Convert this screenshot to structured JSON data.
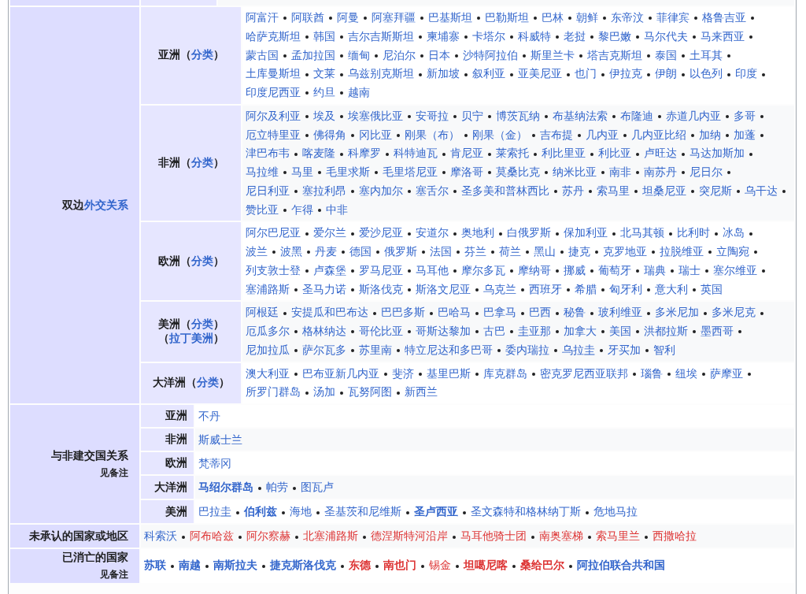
{
  "sections": [
    {
      "label": [
        {
          "text": "双边",
          "link": false
        },
        {
          "text": "外交关系",
          "link": true
        }
      ],
      "rows": [
        {
          "label": [
            [
              {
                "text": "亚洲（",
                "link": false
              },
              {
                "text": "分类",
                "link": true
              },
              {
                "text": "）",
                "link": false
              }
            ]
          ],
          "items": [
            "阿富汗",
            "阿联酋",
            "阿曼",
            "阿塞拜疆",
            "巴基斯坦",
            "巴勒斯坦",
            "巴林",
            "朝鲜",
            "东帝汶",
            "菲律宾",
            "格鲁吉亚",
            "哈萨克斯坦",
            "韩国",
            "吉尔吉斯斯坦",
            "柬埔寨",
            "卡塔尔",
            "科威特",
            "老挝",
            "黎巴嫩",
            "马尔代夫",
            "马来西亚",
            "蒙古国",
            "孟加拉国",
            "缅甸",
            "尼泊尔",
            "日本",
            "沙特阿拉伯",
            "斯里兰卡",
            "塔吉克斯坦",
            "泰国",
            "土耳其",
            "土库曼斯坦",
            "文莱",
            "乌兹别克斯坦",
            "新加坡",
            "叙利亚",
            "亚美尼亚",
            "也门",
            "伊拉克",
            "伊朗",
            "以色列",
            "印度",
            "印度尼西亚",
            "约旦",
            "越南"
          ]
        },
        {
          "label": [
            [
              {
                "text": "非洲（",
                "link": false
              },
              {
                "text": "分类",
                "link": true
              },
              {
                "text": "）",
                "link": false
              }
            ]
          ],
          "items": [
            "阿尔及利亚",
            "埃及",
            "埃塞俄比亚",
            "安哥拉",
            "贝宁",
            "博茨瓦纳",
            "布基纳法索",
            "布隆迪",
            "赤道几内亚",
            "多哥",
            "厄立特里亚",
            "佛得角",
            "冈比亚",
            "刚果（布）",
            "刚果（金）",
            "吉布提",
            "几内亚",
            "几内亚比绍",
            "加纳",
            "加蓬",
            "津巴布韦",
            "喀麦隆",
            "科摩罗",
            "科特迪瓦",
            "肯尼亚",
            "莱索托",
            "利比里亚",
            "利比亚",
            "卢旺达",
            "马达加斯加",
            "马拉维",
            "马里",
            "毛里求斯",
            "毛里塔尼亚",
            "摩洛哥",
            "莫桑比克",
            "纳米比亚",
            "南非",
            "南苏丹",
            "尼日尔",
            "尼日利亚",
            "塞拉利昂",
            "塞内加尔",
            "塞舌尔",
            "圣多美和普林西比",
            "苏丹",
            "索马里",
            "坦桑尼亚",
            "突尼斯",
            "乌干达",
            "赞比亚",
            "乍得",
            "中非"
          ]
        },
        {
          "label": [
            [
              {
                "text": "欧洲（",
                "link": false
              },
              {
                "text": "分类",
                "link": true
              },
              {
                "text": "）",
                "link": false
              }
            ]
          ],
          "items": [
            "阿尔巴尼亚",
            "爱尔兰",
            "爱沙尼亚",
            "安道尔",
            "奥地利",
            "白俄罗斯",
            "保加利亚",
            "北马其顿",
            "比利时",
            "冰岛",
            "波兰",
            "波黑",
            "丹麦",
            "德国",
            "俄罗斯",
            "法国",
            "芬兰",
            "荷兰",
            "黑山",
            "捷克",
            "克罗地亚",
            "拉脱维亚",
            "立陶宛",
            "列支敦士登",
            "卢森堡",
            "罗马尼亚",
            "马耳他",
            "摩尔多瓦",
            "摩纳哥",
            "挪威",
            "葡萄牙",
            "瑞典",
            "瑞士",
            "塞尔维亚",
            "塞浦路斯",
            "圣马力诺",
            "斯洛伐克",
            "斯洛文尼亚",
            "乌克兰",
            "西班牙",
            "希腊",
            "匈牙利",
            "意大利",
            "英国"
          ]
        },
        {
          "label": [
            [
              {
                "text": "美洲（",
                "link": false
              },
              {
                "text": "分类",
                "link": true
              },
              {
                "text": "）",
                "link": false
              }
            ],
            [
              {
                "text": "（",
                "link": false
              },
              {
                "text": "拉丁美洲",
                "link": true
              },
              {
                "text": "）",
                "link": false
              }
            ]
          ],
          "items": [
            "阿根廷",
            "安提瓜和巴布达",
            "巴巴多斯",
            "巴哈马",
            "巴拿马",
            "巴西",
            "秘鲁",
            "玻利维亚",
            "多米尼加",
            "多米尼克",
            "厄瓜多尔",
            "格林纳达",
            "哥伦比亚",
            "哥斯达黎加",
            "古巴",
            "圭亚那",
            "加拿大",
            "美国",
            "洪都拉斯",
            "墨西哥",
            "尼加拉瓜",
            "萨尔瓦多",
            "苏里南",
            "特立尼达和多巴哥",
            "委内瑞拉",
            "乌拉圭",
            "牙买加",
            "智利"
          ]
        },
        {
          "label": [
            [
              {
                "text": "大洋洲（",
                "link": false
              },
              {
                "text": "分类",
                "link": true
              },
              {
                "text": "）",
                "link": false
              }
            ]
          ],
          "items": [
            "澳大利亚",
            "巴布亚新几内亚",
            "斐济",
            "基里巴斯",
            "库克群岛",
            "密克罗尼西亚联邦",
            "瑙鲁",
            "纽埃",
            "萨摩亚",
            "所罗门群岛",
            "汤加",
            "瓦努阿图",
            "新西兰"
          ]
        }
      ]
    },
    {
      "label": [
        {
          "text": "与非建交国关系",
          "link": false
        }
      ],
      "note": "见备注",
      "rows": [
        {
          "label": [
            [
              {
                "text": "亚洲",
                "link": false
              }
            ]
          ],
          "items": [
            "不丹"
          ]
        },
        {
          "label": [
            [
              {
                "text": "非洲",
                "link": false
              }
            ]
          ],
          "items": [
            "斯威士兰"
          ]
        },
        {
          "label": [
            [
              {
                "text": "欧洲",
                "link": false
              }
            ]
          ],
          "items": [
            "梵蒂冈"
          ]
        },
        {
          "label": [
            [
              {
                "text": "大洋洲",
                "link": false
              }
            ]
          ],
          "items": [
            {
              "text": "马绍尔群岛",
              "color": "#3366cc",
              "bold": true
            },
            {
              "text": "帕劳",
              "color": "#3366cc",
              "bold": false
            },
            {
              "text": "图瓦卢",
              "color": "#3366cc",
              "bold": false
            }
          ]
        },
        {
          "label": [
            [
              {
                "text": "美洲",
                "link": false
              }
            ]
          ],
          "items": [
            {
              "text": "巴拉圭",
              "color": "#3366cc",
              "bold": false
            },
            {
              "text": "伯利兹",
              "color": "#3366cc",
              "bold": true
            },
            {
              "text": "海地",
              "color": "#3366cc",
              "bold": false
            },
            {
              "text": "圣基茨和尼维斯",
              "color": "#3366cc",
              "bold": false
            },
            {
              "text": "圣卢西亚",
              "color": "#3366cc",
              "bold": true
            },
            {
              "text": "圣文森特和格林纳丁斯",
              "color": "#3366cc",
              "bold": false
            },
            {
              "text": "危地马拉",
              "color": "#3366cc",
              "bold": false
            }
          ]
        }
      ]
    },
    {
      "label": [
        {
          "text": "未承认的国家或地区",
          "link": false
        }
      ],
      "items": [
        {
          "text": "科索沃",
          "color": "#3366cc",
          "bold": false
        },
        {
          "text": "阿布哈兹",
          "color": "#dd3333",
          "bold": false
        },
        {
          "text": "阿尔察赫",
          "color": "#dd3333",
          "bold": false
        },
        {
          "text": "北塞浦路斯",
          "color": "#dd3333",
          "bold": false
        },
        {
          "text": "德涅斯特河沿岸",
          "color": "#dd3333",
          "bold": false
        },
        {
          "text": "马耳他骑士团",
          "color": "#dd3333",
          "bold": false
        },
        {
          "text": "南奥塞梯",
          "color": "#dd3333",
          "bold": false
        },
        {
          "text": "索马里兰",
          "color": "#dd3333",
          "bold": false
        },
        {
          "text": "西撒哈拉",
          "color": "#dd3333",
          "bold": false
        }
      ]
    },
    {
      "label": [
        {
          "text": "已消亡的国家",
          "link": false
        }
      ],
      "note": "见备注",
      "items": [
        {
          "text": "苏联",
          "color": "#3366cc",
          "bold": true
        },
        {
          "text": "南越",
          "color": "#3366cc",
          "bold": true
        },
        {
          "text": "南斯拉夫",
          "color": "#3366cc",
          "bold": true
        },
        {
          "text": "捷克斯洛伐克",
          "color": "#3366cc",
          "bold": true
        },
        {
          "text": "东德",
          "color": "#dd3333",
          "bold": true
        },
        {
          "text": "南也门",
          "color": "#dd3333",
          "bold": true
        },
        {
          "text": "锡金",
          "color": "#dd3333",
          "bold": false
        },
        {
          "text": "坦噶尼喀",
          "color": "#dd3333",
          "bold": true
        },
        {
          "text": "桑给巴尔",
          "color": "#dd3333",
          "bold": true
        },
        {
          "text": "阿拉伯联合共和国",
          "color": "#3366cc",
          "bold": true
        }
      ]
    }
  ]
}
